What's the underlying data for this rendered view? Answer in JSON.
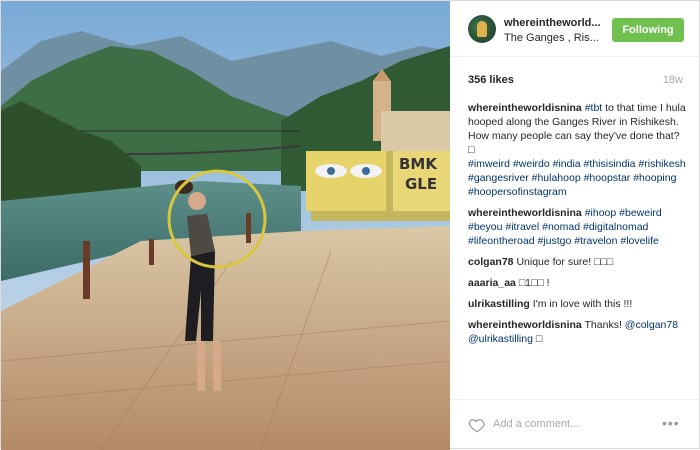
{
  "post": {
    "username": "whereintheworld...",
    "location": "The Ganges , Ris...",
    "follow_label": "Following",
    "likes": "356 likes",
    "age": "18w"
  },
  "comments": [
    {
      "user": "whereintheworldisnina",
      "tag_lead": "#tbt",
      "text": " to that time I hula hooped along the Ganges River in Rishikesh.\nHow many people can say they've done that? ",
      "emoji": "□",
      "tags": "#imweird #weirdo #india #thisisindia #rishikesh #gangesriver #hulahoop #hoopstar #hooping #hoopersofinstagram"
    },
    {
      "user": "whereintheworldisnina",
      "tags": "#ihoop #beweird #beyou #itravel #nomad #digitalnomad #lifeontheroad #justgo #travelon #lovelife"
    },
    {
      "user": "colgan78",
      "text": "Unique for sure! □□□"
    },
    {
      "user": "aaaria_aa",
      "text": "□1□□ !"
    },
    {
      "user": "ulrikastilling",
      "text": "I'm in love with this !!!"
    },
    {
      "user": "whereintheworldisnina",
      "text": "Thanks! ",
      "mention1": "@colgan78",
      "mention2": "@ulrikastilling",
      "trail": " □"
    }
  ],
  "footer": {
    "add_comment_placeholder": "Add a comment...",
    "more_label": "•••"
  },
  "icons": {
    "heart": "heart-icon",
    "more": "more-options-icon"
  },
  "colors": {
    "follow_button": "#70c050",
    "hashtag": "#003569",
    "muted": "#a5a7aa"
  }
}
